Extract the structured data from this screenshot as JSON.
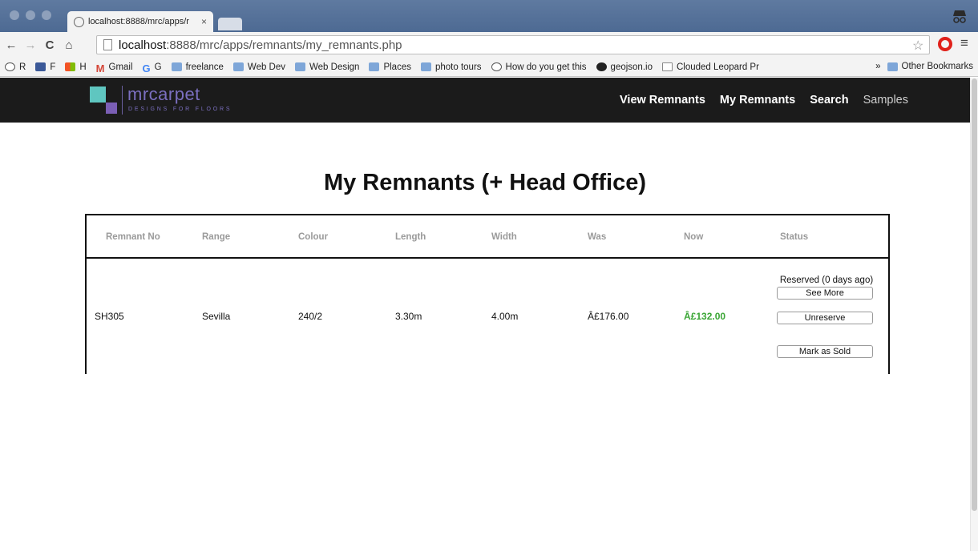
{
  "browser": {
    "tab_title": "localhost:8888/mrc/apps/r",
    "tab_close": "×",
    "url_host": "localhost",
    "url_path": ":8888/mrc/apps/remnants/my_remnants.php",
    "bookmarks": [
      {
        "icon": "reddit",
        "label": "R"
      },
      {
        "icon": "facebook",
        "label": "F"
      },
      {
        "icon": "windows",
        "label": "H"
      },
      {
        "icon": "gmail",
        "label": "Gmail"
      },
      {
        "icon": "google",
        "label": "G"
      },
      {
        "icon": "folder",
        "label": "freelance"
      },
      {
        "icon": "folder",
        "label": "Web Dev"
      },
      {
        "icon": "folder",
        "label": "Web Design"
      },
      {
        "icon": "folder",
        "label": "Places"
      },
      {
        "icon": "folder",
        "label": "photo tours"
      },
      {
        "icon": "reddit",
        "label": "How do you get this"
      },
      {
        "icon": "geojson",
        "label": "geojson.io"
      },
      {
        "icon": "document",
        "label": "Clouded Leopard Pr"
      }
    ],
    "overflow": "»",
    "other_bookmarks": "Other Bookmarks"
  },
  "site": {
    "logo_name": "mrcarpet",
    "logo_tagline": "DESIGNS FOR FLOORS",
    "nav": {
      "view_remnants": "View Remnants",
      "my_remnants": "My Remnants",
      "search": "Search",
      "samples": "Samples"
    },
    "colors": {
      "header_bg": "#1b1b1b",
      "logo_teal": "#5fc6c0",
      "logo_purple": "#7b5fb5",
      "price_now": "#3aa635"
    }
  },
  "page": {
    "title": "My Remnants (+ Head Office)",
    "columns": [
      "Remnant No",
      "Range",
      "Colour",
      "Length",
      "Width",
      "Was",
      "Now",
      "Status"
    ],
    "rows": [
      {
        "remnant_no": "SH305",
        "range": "Sevilla",
        "colour": "240/2",
        "length": "3.30m",
        "width": "4.00m",
        "was": "Â£176.00",
        "now": "Â£132.00",
        "status": "Reserved (0 days ago)",
        "btn_see_more": "See More",
        "btn_unreserve": "Unreserve",
        "btn_mark_sold": "Mark as Sold"
      }
    ]
  }
}
